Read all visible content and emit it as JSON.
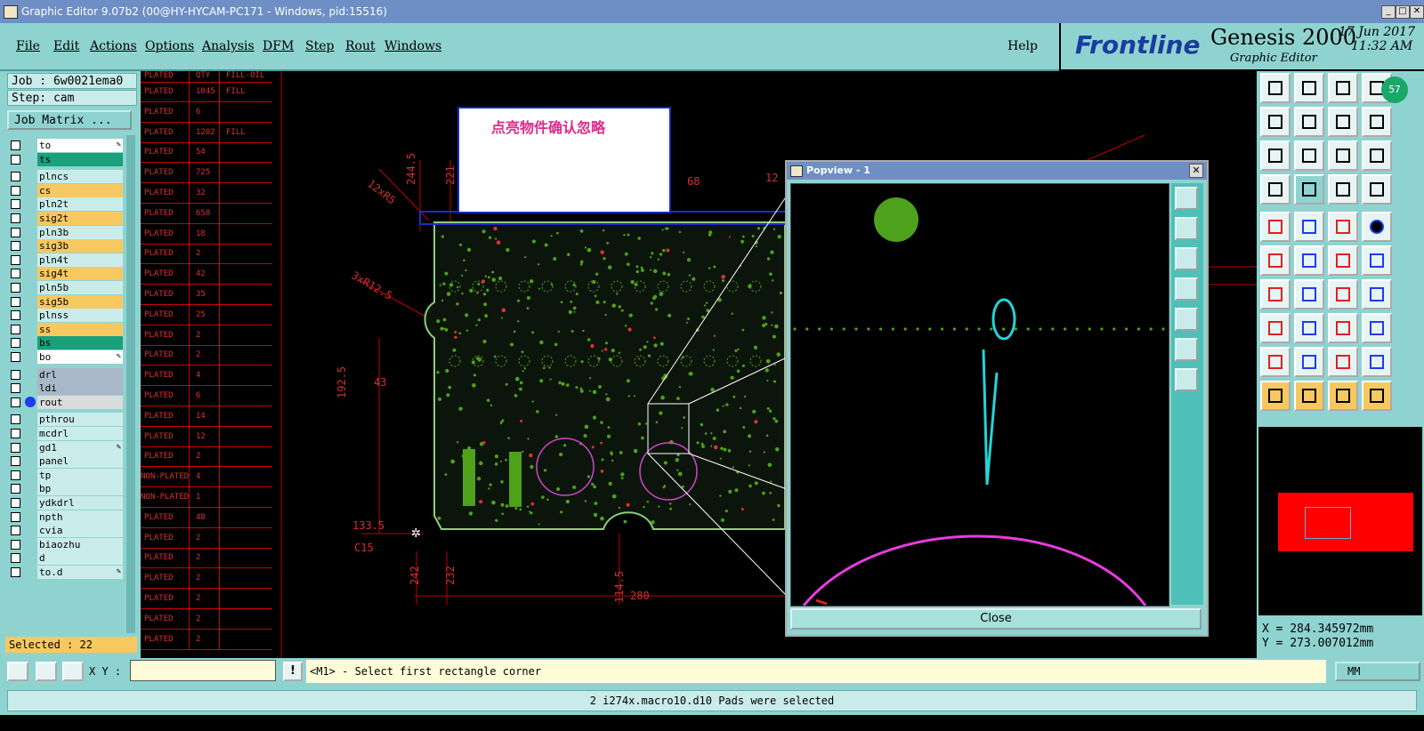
{
  "window": {
    "title": "Graphic Editor 9.07b2 (00@HY-HYCAM-PC171 - Windows, pid:15516)"
  },
  "menu": [
    "File",
    "Edit",
    "Actions",
    "Options",
    "Analysis",
    "DFM",
    "Step",
    "Rout",
    "Windows"
  ],
  "help": "Help",
  "brand": {
    "logo": "Frontline",
    "product": "Genesis 2000",
    "subtitle": "Graphic Editor",
    "date": "17 Jun 2017",
    "time": "11:32 AM"
  },
  "job": {
    "job_label": "Job : 6w0021ema0",
    "step_label": "Step: cam",
    "matrix_button": "Job Matrix ..."
  },
  "layers": [
    {
      "name": "to",
      "bg": "#ffffff",
      "mark": "✎"
    },
    {
      "name": "ts",
      "bg": "#1aa07a"
    },
    {
      "name": "plncs",
      "bg": "#c9ecea"
    },
    {
      "name": "cs",
      "bg": "#f8c860"
    },
    {
      "name": "pln2t",
      "bg": "#c9ecea"
    },
    {
      "name": "sig2t",
      "bg": "#f8c860"
    },
    {
      "name": "pln3b",
      "bg": "#c9ecea"
    },
    {
      "name": "sig3b",
      "bg": "#f8c860"
    },
    {
      "name": "pln4t",
      "bg": "#c9ecea"
    },
    {
      "name": "sig4t",
      "bg": "#f8c860"
    },
    {
      "name": "pln5b",
      "bg": "#c9ecea"
    },
    {
      "name": "sig5b",
      "bg": "#f8c860"
    },
    {
      "name": "plnss",
      "bg": "#c9ecea"
    },
    {
      "name": "ss",
      "bg": "#f8c860"
    },
    {
      "name": "bs",
      "bg": "#1aa07a"
    },
    {
      "name": "bo",
      "bg": "#ffffff",
      "mark": "✎"
    },
    {
      "name": "drl",
      "bg": "#a8b8c8"
    },
    {
      "name": "ldi",
      "bg": "#a8b8c8"
    },
    {
      "name": "rout",
      "bg": "#d8dcdc",
      "dot": true
    },
    {
      "name": "pthrou",
      "bg": "#c9ecea"
    },
    {
      "name": "mcdrl",
      "bg": "#c9ecea"
    },
    {
      "name": "gd1",
      "bg": "#c9ecea",
      "mark": "✎"
    },
    {
      "name": "panel",
      "bg": "#c9ecea"
    },
    {
      "name": "tp",
      "bg": "#c9ecea"
    },
    {
      "name": "bp",
      "bg": "#c9ecea"
    },
    {
      "name": "ydkdrl",
      "bg": "#c9ecea"
    },
    {
      "name": "npth",
      "bg": "#c9ecea"
    },
    {
      "name": "cvia",
      "bg": "#c9ecea"
    },
    {
      "name": "biaozhu",
      "bg": "#c9ecea"
    },
    {
      "name": "d",
      "bg": "#c9ecea"
    },
    {
      "name": "to.d",
      "bg": "#c9ecea",
      "mark": "✎"
    }
  ],
  "selected_count": "Selected : 22",
  "drill_table": {
    "headers": [
      "PLATED",
      "QTY",
      "FILL-OIL"
    ],
    "rows": [
      [
        "PLATED",
        "1045",
        "FILL"
      ],
      [
        "PLATED",
        "6",
        ""
      ],
      [
        "PLATED",
        "1202",
        "FILL"
      ],
      [
        "PLATED",
        "54",
        ""
      ],
      [
        "PLATED",
        "725",
        ""
      ],
      [
        "PLATED",
        "32",
        ""
      ],
      [
        "PLATED",
        "658",
        ""
      ],
      [
        "PLATED",
        "18",
        ""
      ],
      [
        "PLATED",
        "2",
        ""
      ],
      [
        "PLATED",
        "42",
        ""
      ],
      [
        "PLATED",
        "35",
        ""
      ],
      [
        "PLATED",
        "25",
        ""
      ],
      [
        "PLATED",
        "2",
        ""
      ],
      [
        "PLATED",
        "2",
        ""
      ],
      [
        "PLATED",
        "4",
        ""
      ],
      [
        "PLATED",
        "6",
        ""
      ],
      [
        "PLATED",
        "14",
        ""
      ],
      [
        "PLATED",
        "12",
        ""
      ],
      [
        "PLATED",
        "2",
        ""
      ],
      [
        "NON-PLATED",
        "4",
        ""
      ],
      [
        "NON-PLATED",
        "1",
        ""
      ],
      [
        "PLATED",
        "48",
        ""
      ],
      [
        "PLATED",
        "2",
        ""
      ],
      [
        "PLATED",
        "2",
        ""
      ],
      [
        "PLATED",
        "2",
        ""
      ],
      [
        "PLATED",
        "2",
        ""
      ],
      [
        "PLATED",
        "2",
        ""
      ],
      [
        "PLATED",
        "2",
        ""
      ]
    ]
  },
  "canvas": {
    "note": "点亮物件确认忽略",
    "dims": [
      "12xR5",
      "244.5",
      "221",
      "68",
      "12",
      "3xR12.5",
      "192.5",
      "43",
      "133.5",
      "C15",
      "242",
      "232",
      "114.5",
      "280"
    ]
  },
  "popview": {
    "title": "Popview - 1",
    "close_label": "Close"
  },
  "right_panel": {
    "badge": "57",
    "coord_x": "X = 284.345972mm",
    "coord_y": "Y = 273.007012mm"
  },
  "command": {
    "xy_label": "X Y :",
    "xy_value": "",
    "prompt": "<M1> - Select first rectangle corner",
    "unit": "MM"
  },
  "status": "2 i274x.macro10.d10 Pads were selected",
  "colors": {
    "panel": "#8fd3d0",
    "highlight": "#f8c860",
    "drill_text": "#e03030",
    "note_text": "#e0288a"
  }
}
